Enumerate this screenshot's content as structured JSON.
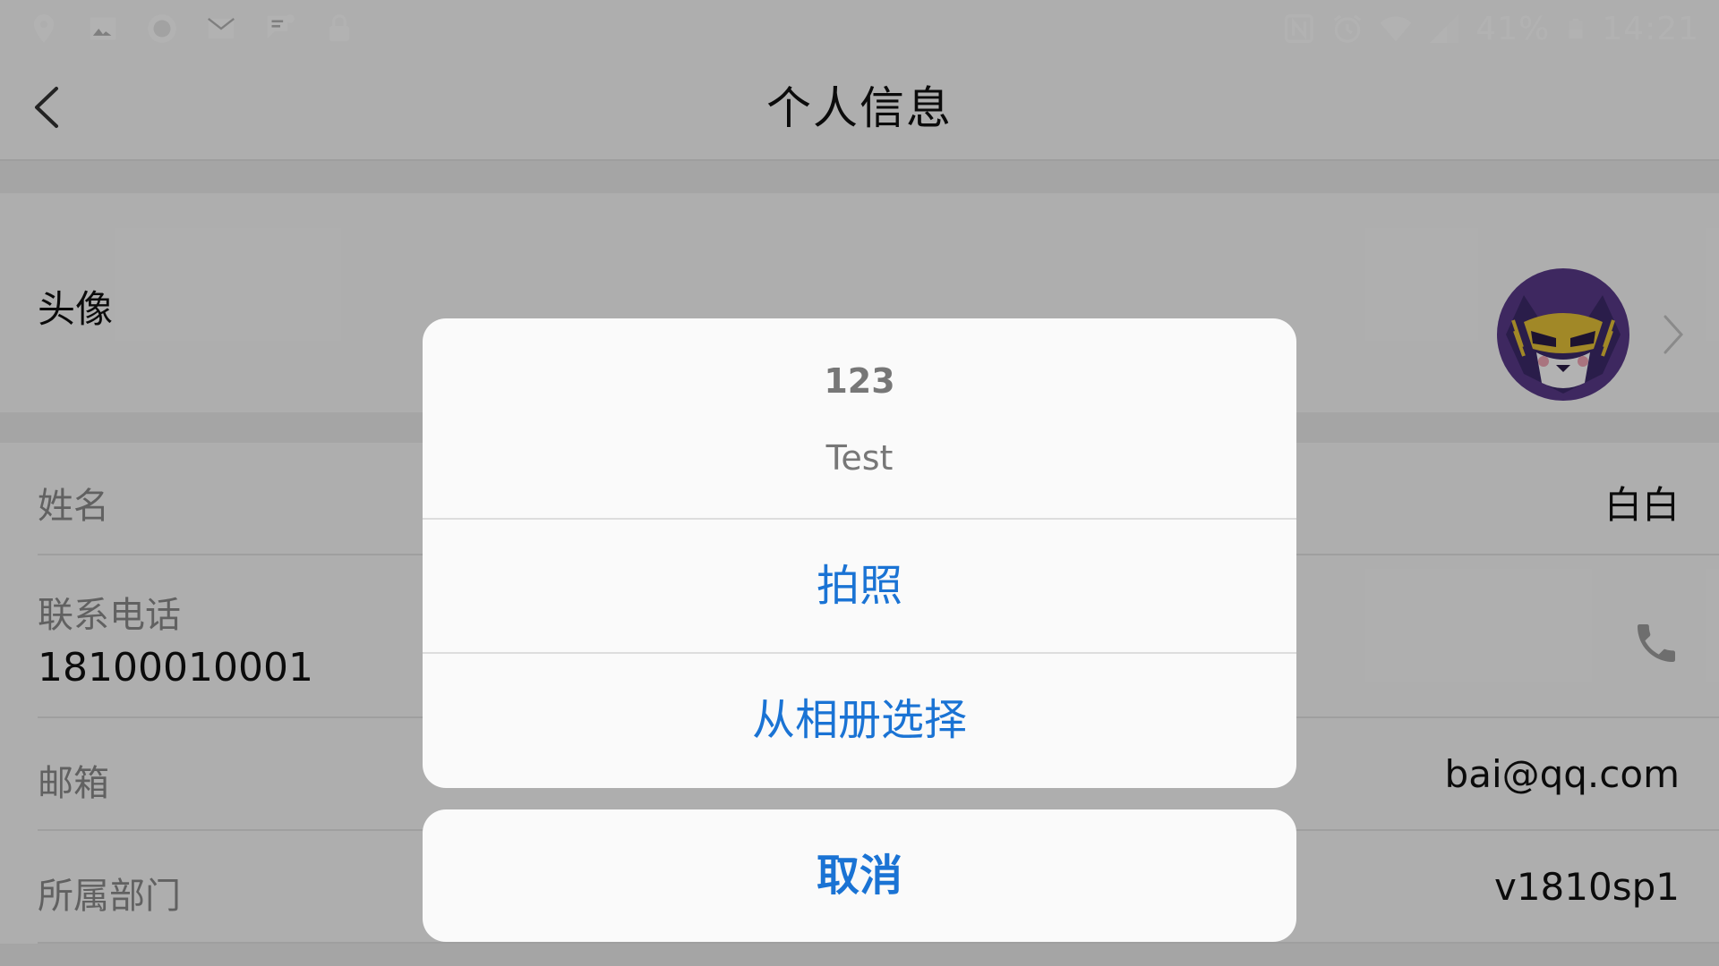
{
  "status_bar": {
    "battery": "41%",
    "time": "14:21",
    "left_icons": [
      "location-icon",
      "image-icon",
      "app-icon",
      "mail-icon",
      "message-icon",
      "lock-icon"
    ],
    "right_icons": [
      "nfc-icon",
      "alarm-icon",
      "wifi-icon",
      "signal-icon",
      "battery-icon"
    ]
  },
  "nav": {
    "title": "个人信息",
    "back_icon": "chevron-left-icon"
  },
  "profile": {
    "avatar_label": "头像",
    "name_label": "姓名",
    "name_value": "白白",
    "phone_label": "联系电话",
    "phone_value": "18100010001",
    "email_label": "邮箱",
    "email_value": "bai@qq.com",
    "department_label": "所属部门",
    "department_value": "v1810sp1"
  },
  "action_sheet": {
    "title": "123",
    "message": "Test",
    "options": [
      {
        "label": "拍照"
      },
      {
        "label": "从相册选择"
      }
    ],
    "cancel_label": "取消"
  },
  "colors": {
    "accent": "#1a73d4",
    "overlay": "rgba(0,0,0,0.30)",
    "sheet_background": "#fafafa"
  }
}
